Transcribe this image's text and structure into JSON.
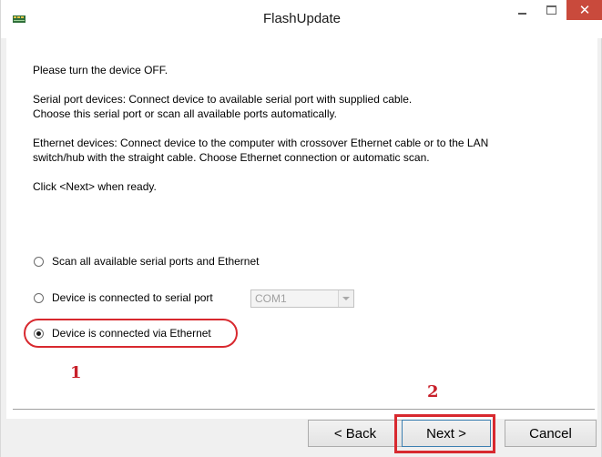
{
  "window": {
    "title": "FlashUpdate",
    "icon": "app-chip-icon",
    "controls": {
      "minimize": "minimize-icon",
      "maximize": "maximize-icon",
      "close": "✕"
    }
  },
  "instructions": {
    "line1": "Please turn the device OFF.",
    "serial_line1": "Serial port devices: Connect device to available serial port with supplied cable.",
    "serial_line2": "Choose this serial port or scan all available ports automatically.",
    "ethernet_line1": "Ethernet devices: Connect device to the computer with crossover Ethernet cable or to the LAN",
    "ethernet_line2": "switch/hub with the straight cable. Choose Ethernet connection or automatic scan.",
    "click_next": "Click <Next> when ready."
  },
  "options": [
    {
      "label": "Scan all available serial ports and Ethernet",
      "checked": false
    },
    {
      "label": "Device is connected to serial port",
      "checked": false
    },
    {
      "label": "Device is connected via Ethernet",
      "checked": true
    }
  ],
  "serial_port_select": {
    "value": "COM1",
    "disabled": true
  },
  "annotations": {
    "step1": "1",
    "step2": "2",
    "color": "#d8292f"
  },
  "buttons": {
    "back": "< Back",
    "next": "Next >",
    "cancel": "Cancel"
  }
}
